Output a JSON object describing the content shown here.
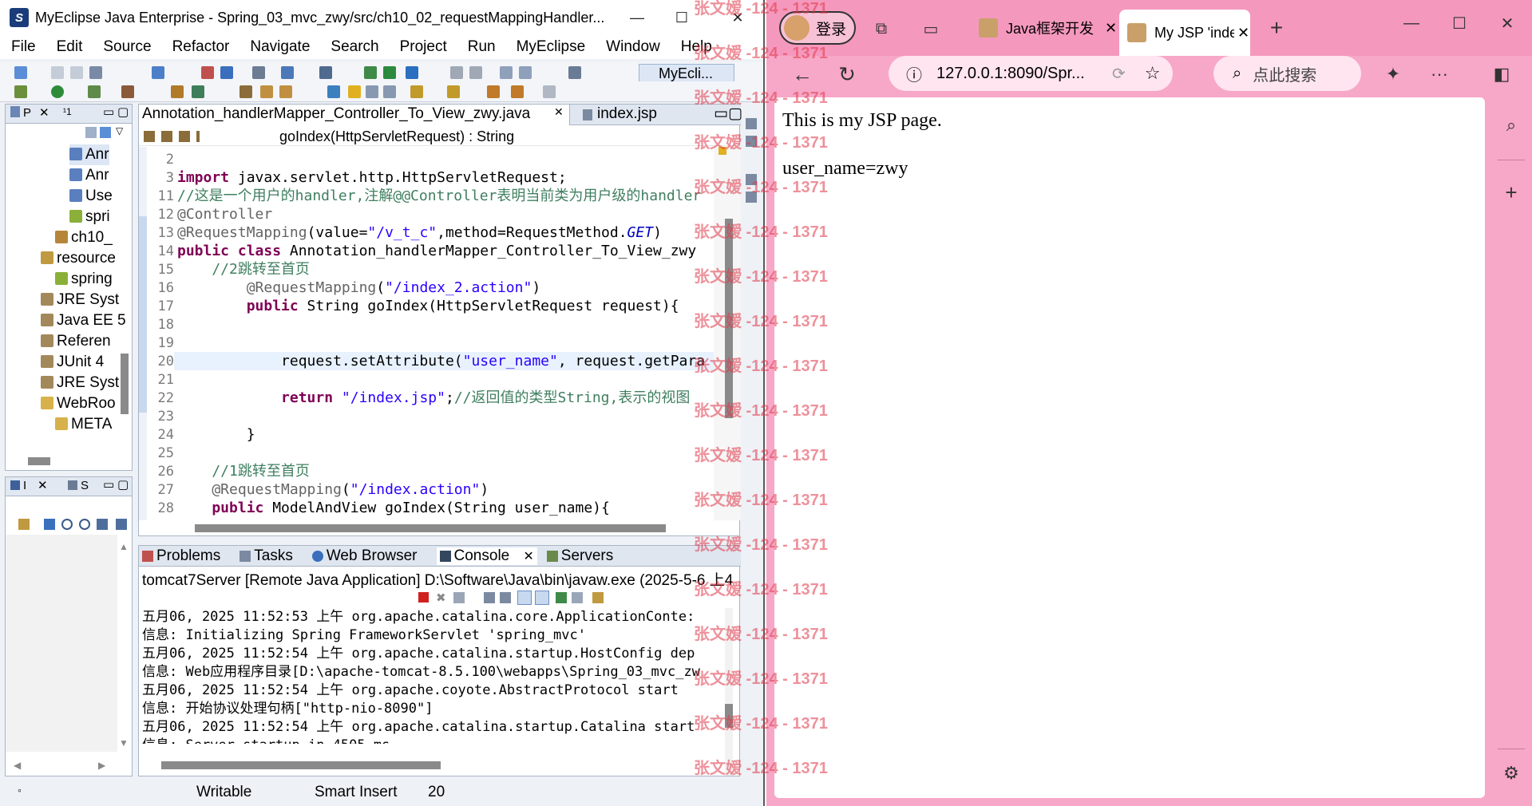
{
  "eclipse": {
    "title": "MyEclipse Java Enterprise - Spring_03_mvc_zwy/src/ch10_02_requestMappingHandler...",
    "menu": [
      "File",
      "Edit",
      "Source",
      "Refactor",
      "Navigate",
      "Search",
      "Project",
      "Run",
      "MyEclipse",
      "Window",
      "Help"
    ],
    "perspective_label": "MyEcli...",
    "package_tab": "P",
    "hierarchy_tab": "¹1",
    "tree": [
      "Anr",
      "Anr",
      "Use",
      "spri",
      "ch10_",
      "resource",
      "spring",
      "JRE Syst",
      "Java EE 5",
      "Referen",
      "JUnit 4",
      "JRE Syst",
      "WebRoo",
      "META"
    ],
    "outline_tab_a": "I",
    "outline_tab_b": "S",
    "editor": {
      "tab_active": "Annotation_handlerMapper_Controller_To_View_zwy.java",
      "tab_other": "index.jsp",
      "breadcrumb": "goIndex(HttpServletRequest) : String",
      "lines": [
        {
          "n": "2",
          "segs": []
        },
        {
          "n": "3",
          "segs": [
            {
              "c": "kw",
              "t": "import"
            },
            {
              "c": "",
              "t": " javax.servlet.http.HttpServletRequest;"
            }
          ]
        },
        {
          "n": "11",
          "segs": [
            {
              "c": "cm",
              "t": "//这是一个用户的handler,注解@@Controller表明当前类为用户级的handler"
            }
          ]
        },
        {
          "n": "12",
          "segs": [
            {
              "c": "an",
              "t": "@Controller"
            }
          ]
        },
        {
          "n": "13",
          "segs": [
            {
              "c": "an",
              "t": "@RequestMapping"
            },
            {
              "c": "",
              "t": "(value="
            },
            {
              "c": "st",
              "t": "\"/v_t_c\""
            },
            {
              "c": "",
              "t": ",method=RequestMethod."
            },
            {
              "c": "it",
              "t": "GET"
            },
            {
              "c": "",
              "t": ")"
            }
          ]
        },
        {
          "n": "14",
          "segs": [
            {
              "c": "kw",
              "t": "public class"
            },
            {
              "c": "",
              "t": " Annotation_handlerMapper_Controller_To_View_zwy"
            }
          ]
        },
        {
          "n": "15",
          "segs": [
            {
              "c": "cm",
              "t": "    //2跳转至首页"
            }
          ]
        },
        {
          "n": "16",
          "segs": [
            {
              "c": "an",
              "t": "        @RequestMapping"
            },
            {
              "c": "",
              "t": "("
            },
            {
              "c": "st",
              "t": "\"/index_2.action\""
            },
            {
              "c": "",
              "t": ")"
            }
          ]
        },
        {
          "n": "17",
          "segs": [
            {
              "c": "kw",
              "t": "        public"
            },
            {
              "c": "",
              "t": " String goIndex(HttpServletRequest request){"
            }
          ]
        },
        {
          "n": "18",
          "segs": []
        },
        {
          "n": "19",
          "segs": []
        },
        {
          "n": "20",
          "segs": [
            {
              "c": "",
              "t": "            request.setAttribute("
            },
            {
              "c": "st",
              "t": "\"user_name\""
            },
            {
              "c": "",
              "t": ", request.getPara"
            }
          ]
        },
        {
          "n": "21",
          "segs": []
        },
        {
          "n": "22",
          "segs": [
            {
              "c": "kw",
              "t": "            return"
            },
            {
              "c": "",
              "t": " "
            },
            {
              "c": "st",
              "t": "\"/index.jsp\""
            },
            {
              "c": "",
              "t": ";"
            },
            {
              "c": "cm",
              "t": "//返回值的类型String,表示的视图"
            }
          ]
        },
        {
          "n": "23",
          "segs": []
        },
        {
          "n": "24",
          "segs": [
            {
              "c": "",
              "t": "        }"
            }
          ]
        },
        {
          "n": "25",
          "segs": []
        },
        {
          "n": "26",
          "segs": [
            {
              "c": "cm",
              "t": "    //1跳转至首页"
            }
          ]
        },
        {
          "n": "27",
          "segs": [
            {
              "c": "an",
              "t": "    @RequestMapping"
            },
            {
              "c": "",
              "t": "("
            },
            {
              "c": "st",
              "t": "\"/index.action\""
            },
            {
              "c": "",
              "t": ")"
            }
          ]
        },
        {
          "n": "28",
          "segs": [
            {
              "c": "kw",
              "t": "    public"
            },
            {
              "c": "",
              "t": " ModelAndView goIndex(String user_name){"
            }
          ]
        }
      ]
    },
    "console": {
      "tabs": [
        "Problems",
        "Tasks",
        "Web Browser",
        "Console",
        "Servers"
      ],
      "launch": "tomcat7Server [Remote Java Application] D:\\Software\\Java\\bin\\javaw.exe (2025-5-6 上4",
      "lines": [
        "五月06, 2025 11:52:53 上午 org.apache.catalina.core.ApplicationConte:",
        "信息: Initializing Spring FrameworkServlet 'spring_mvc'",
        "五月06, 2025 11:52:54 上午 org.apache.catalina.startup.HostConfig dep",
        "信息: Web应用程序目录[D:\\apache-tomcat-8.5.100\\webapps\\Spring_03_mvc_zw",
        "五月06, 2025 11:52:54 上午 org.apache.coyote.AbstractProtocol start",
        "信息: 开始协议处理句柄[\"http-nio-8090\"]",
        "五月06, 2025 11:52:54 上午 org.apache.catalina.startup.Catalina start",
        "信息: Server startup in 4505 ms"
      ]
    },
    "status": {
      "writable": "Writable",
      "insert": "Smart Insert",
      "pos": "20"
    }
  },
  "watermark": "张文嫒 -124 - 1371",
  "edge": {
    "login": "登录",
    "tab1": "Java框架开发",
    "tab2": "My JSP 'inde",
    "address": "127.0.0.1:8090/Spr...",
    "search_placeholder": "点此搜索",
    "page_line1": "This is my JSP page.",
    "page_line2": "user_name=zwy"
  },
  "colors": {
    "edge_frame": "#f7a7c7",
    "eclipse_bg": "#eef1f6",
    "watermark": "#e0394a"
  }
}
